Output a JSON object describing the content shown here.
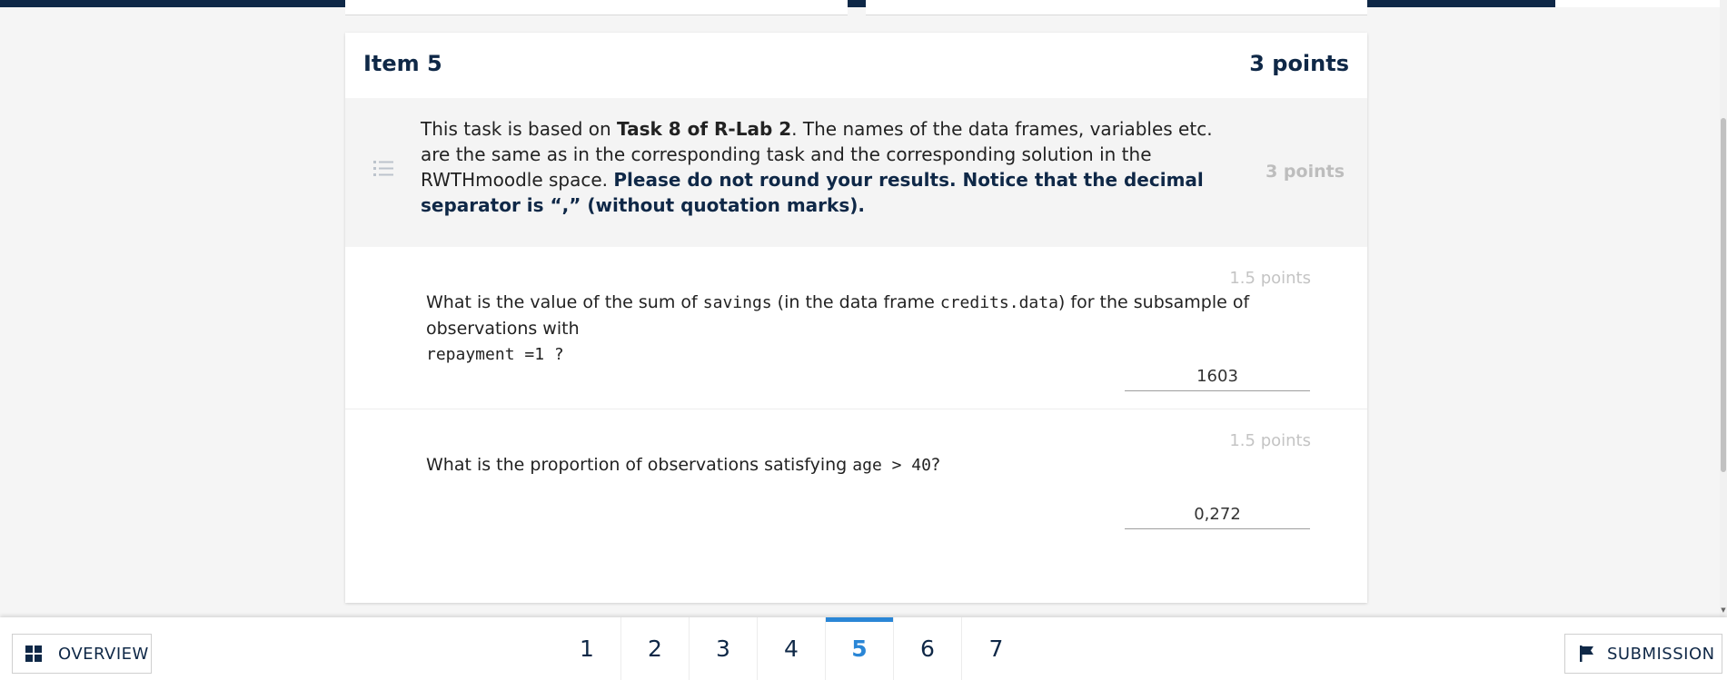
{
  "item": {
    "title": "Item 5",
    "points": "3 points"
  },
  "intro": {
    "t1": "This task is based on ",
    "t2": "Task 8 of R-Lab 2",
    "t3": ". The names of the data frames, variables etc. are the same as in the corresponding task and the corresponding solution in the RWTHmoodle space. ",
    "bold": "Please do not round your results. Notice that the decimal separator is “,” (without quotation marks).",
    "points": "3 points"
  },
  "questions": [
    {
      "points": "1.5 points",
      "p1": "What is the value of the sum of ",
      "c1": "savings",
      "p2": " (in the data frame ",
      "c2": "credits.data",
      "p3": ") for the subsample of observations with ",
      "c3": "repayment =1 ?",
      "p4": "",
      "answer": "1603"
    },
    {
      "points": "1.5 points",
      "p1": "What is the proportion of observations satisfying ",
      "c1": "age > 40",
      "p2": "?",
      "answer": "0,272"
    }
  ],
  "footer": {
    "overview_label": "OVERVIEW",
    "submission_label": "SUBMISSION",
    "pages": [
      "1",
      "2",
      "3",
      "4",
      "5",
      "6",
      "7"
    ],
    "active_page": "5"
  },
  "colors": {
    "navy": "#0f2847",
    "accent": "#2a86d6"
  },
  "icons": {
    "intro": "list-icon",
    "overview": "grid-icon",
    "submission": "flag-icon"
  }
}
